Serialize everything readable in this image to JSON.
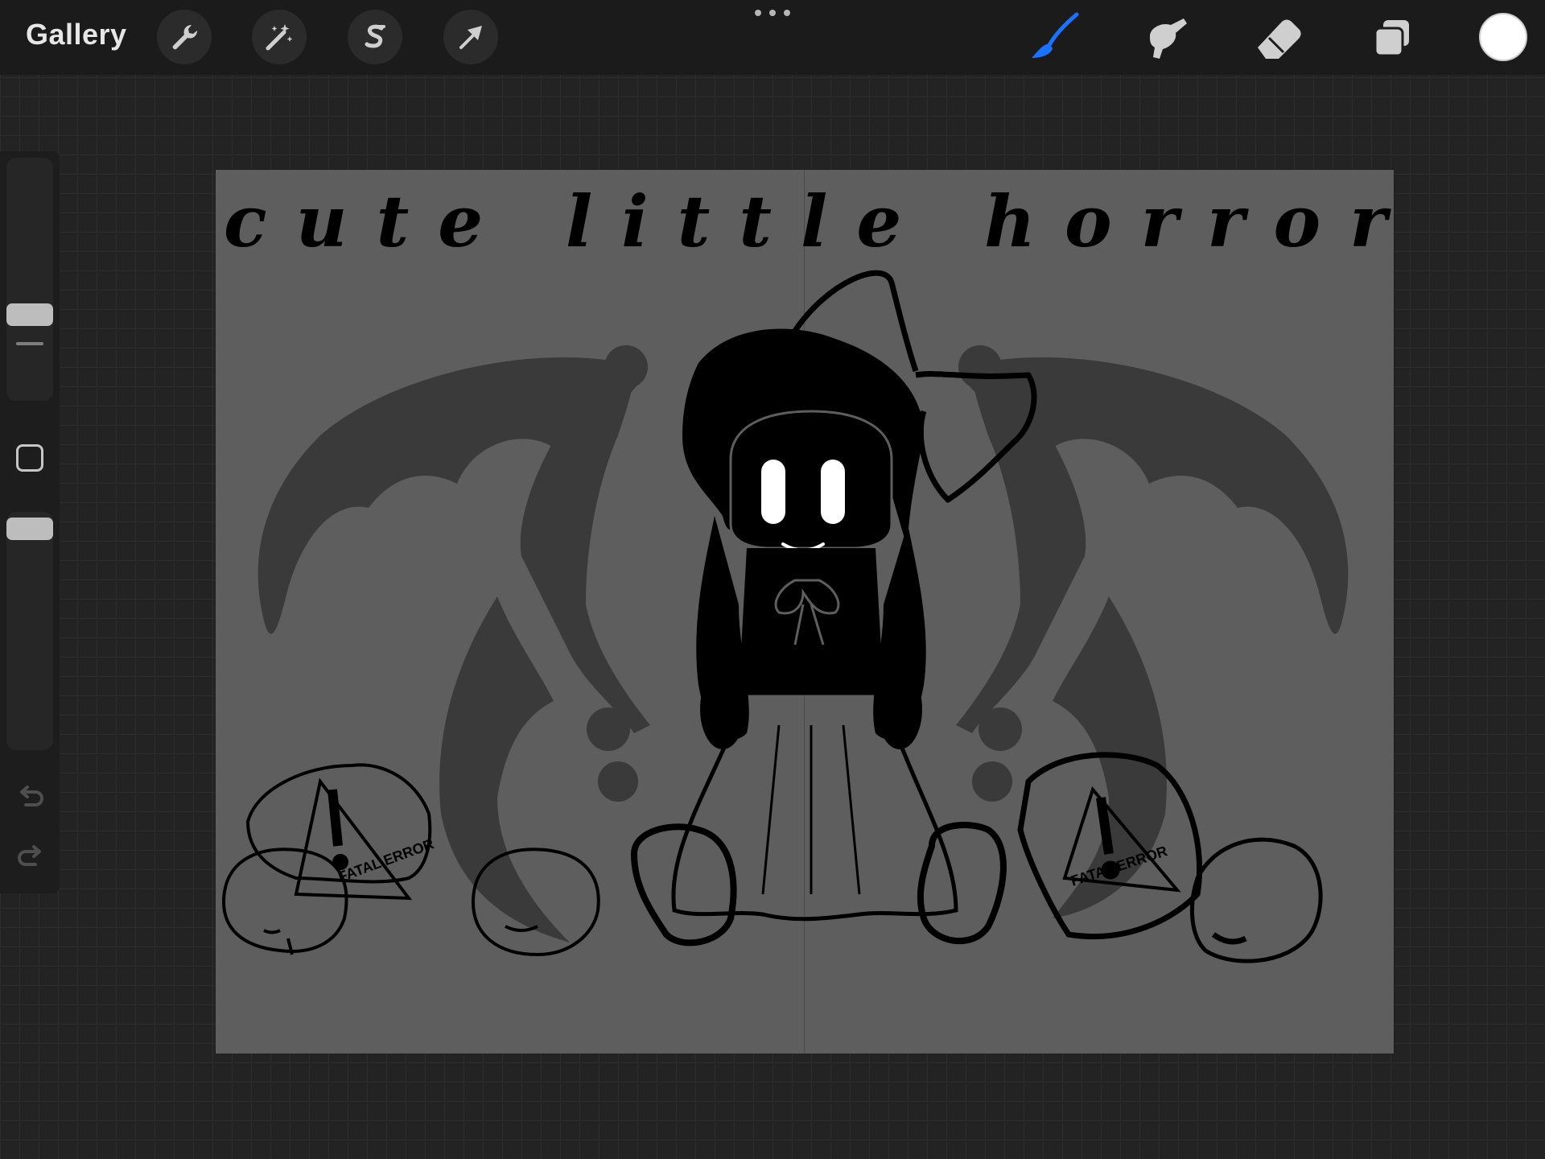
{
  "app": {
    "gallery_label": "Gallery"
  },
  "toolbar_left": [
    {
      "name": "actions",
      "icon": "wrench-icon"
    },
    {
      "name": "adjustments",
      "icon": "magic-wand-icon"
    },
    {
      "name": "selection",
      "icon": "selection-s-icon"
    },
    {
      "name": "transform",
      "icon": "arrow-cursor-icon"
    }
  ],
  "toolbar_right": [
    {
      "name": "brush",
      "icon": "brush-icon",
      "active": true
    },
    {
      "name": "smudge",
      "icon": "smudge-finger-icon"
    },
    {
      "name": "eraser",
      "icon": "eraser-icon"
    },
    {
      "name": "layers",
      "icon": "layers-icon"
    },
    {
      "name": "color",
      "icon": "color-swatch"
    }
  ],
  "colors": {
    "accent_blue": "#1a73ff",
    "current_color": "#ffffff",
    "canvas_bg": "#5e5e5e",
    "wing_gray": "#3a3a3a",
    "ink": "#000000"
  },
  "canvas": {
    "title": "cute little horror",
    "sign_text_left": "FATAL ERROR",
    "sign_text_right": "FATAL ERROR"
  },
  "sidebar": {
    "brush_size_level": 0.62,
    "opacity_level": 0.82
  }
}
